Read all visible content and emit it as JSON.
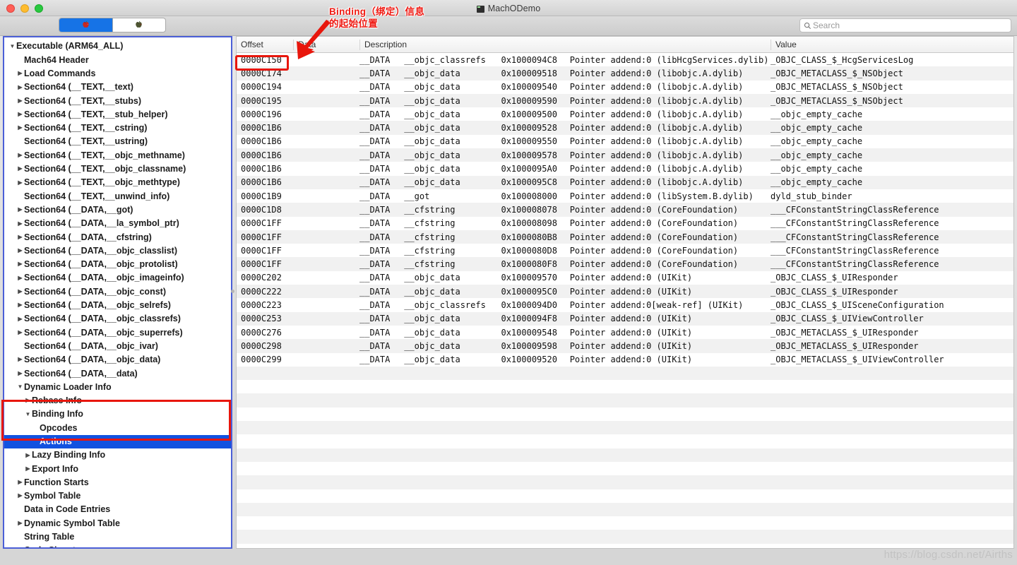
{
  "window": {
    "title": "MachODemo",
    "app_icon": "terminal-icon",
    "traffic_lights": [
      "close-button",
      "minimize-button",
      "zoom-button"
    ]
  },
  "toolbar": {
    "segmented_control": [
      {
        "icon": "red-apple-icon",
        "selected": true
      },
      {
        "icon": "dark-apple-icon",
        "selected": false
      }
    ],
    "search": {
      "icon": "search-icon",
      "placeholder": "Search",
      "value": ""
    }
  },
  "annotation": {
    "line1": "Binding（绑定）信息",
    "line2": "的起始位置",
    "color": "#ef1a13",
    "arrow": "red-arrow-icon"
  },
  "sidebar": {
    "border_color": "#4b5fd7",
    "highlight_box_color": "#e8160c",
    "selection_color": "#1252e0",
    "items": [
      {
        "label": "Executable  (ARM64_ALL)",
        "indent": 0,
        "twisty": "down",
        "selected": false
      },
      {
        "label": "Mach64 Header",
        "indent": 1,
        "twisty": "none",
        "selected": false
      },
      {
        "label": "Load Commands",
        "indent": 1,
        "twisty": "right",
        "selected": false
      },
      {
        "label": "Section64 (__TEXT,__text)",
        "indent": 1,
        "twisty": "right",
        "selected": false
      },
      {
        "label": "Section64 (__TEXT,__stubs)",
        "indent": 1,
        "twisty": "right",
        "selected": false
      },
      {
        "label": "Section64 (__TEXT,__stub_helper)",
        "indent": 1,
        "twisty": "right",
        "selected": false
      },
      {
        "label": "Section64 (__TEXT,__cstring)",
        "indent": 1,
        "twisty": "right",
        "selected": false
      },
      {
        "label": "Section64 (__TEXT,__ustring)",
        "indent": 1,
        "twisty": "none",
        "selected": false
      },
      {
        "label": "Section64 (__TEXT,__objc_methname)",
        "indent": 1,
        "twisty": "right",
        "selected": false
      },
      {
        "label": "Section64 (__TEXT,__objc_classname)",
        "indent": 1,
        "twisty": "right",
        "selected": false
      },
      {
        "label": "Section64 (__TEXT,__objc_methtype)",
        "indent": 1,
        "twisty": "right",
        "selected": false
      },
      {
        "label": "Section64 (__TEXT,__unwind_info)",
        "indent": 1,
        "twisty": "none",
        "selected": false
      },
      {
        "label": "Section64 (__DATA,__got)",
        "indent": 1,
        "twisty": "right",
        "selected": false
      },
      {
        "label": "Section64 (__DATA,__la_symbol_ptr)",
        "indent": 1,
        "twisty": "right",
        "selected": false
      },
      {
        "label": "Section64 (__DATA,__cfstring)",
        "indent": 1,
        "twisty": "right",
        "selected": false
      },
      {
        "label": "Section64 (__DATA,__objc_classlist)",
        "indent": 1,
        "twisty": "right",
        "selected": false
      },
      {
        "label": "Section64 (__DATA,__objc_protolist)",
        "indent": 1,
        "twisty": "right",
        "selected": false
      },
      {
        "label": "Section64 (__DATA,__objc_imageinfo)",
        "indent": 1,
        "twisty": "right",
        "selected": false
      },
      {
        "label": "Section64 (__DATA,__objc_const)",
        "indent": 1,
        "twisty": "right",
        "selected": false
      },
      {
        "label": "Section64 (__DATA,__objc_selrefs)",
        "indent": 1,
        "twisty": "right",
        "selected": false
      },
      {
        "label": "Section64 (__DATA,__objc_classrefs)",
        "indent": 1,
        "twisty": "right",
        "selected": false
      },
      {
        "label": "Section64 (__DATA,__objc_superrefs)",
        "indent": 1,
        "twisty": "right",
        "selected": false
      },
      {
        "label": "Section64 (__DATA,__objc_ivar)",
        "indent": 1,
        "twisty": "none",
        "selected": false
      },
      {
        "label": "Section64 (__DATA,__objc_data)",
        "indent": 1,
        "twisty": "right",
        "selected": false
      },
      {
        "label": "Section64 (__DATA,__data)",
        "indent": 1,
        "twisty": "right",
        "selected": false
      },
      {
        "label": "Dynamic Loader Info",
        "indent": 1,
        "twisty": "down",
        "selected": false
      },
      {
        "label": "Rebase Info",
        "indent": 2,
        "twisty": "right",
        "selected": false
      },
      {
        "label": "Binding Info",
        "indent": 2,
        "twisty": "down",
        "selected": false
      },
      {
        "label": "Opcodes",
        "indent": 3,
        "twisty": "none",
        "selected": false
      },
      {
        "label": "Actions",
        "indent": 3,
        "twisty": "none",
        "selected": true
      },
      {
        "label": "Lazy Binding Info",
        "indent": 2,
        "twisty": "right",
        "selected": false
      },
      {
        "label": "Export Info",
        "indent": 2,
        "twisty": "right",
        "selected": false
      },
      {
        "label": "Function Starts",
        "indent": 1,
        "twisty": "right",
        "selected": false
      },
      {
        "label": "Symbol Table",
        "indent": 1,
        "twisty": "right",
        "selected": false
      },
      {
        "label": "Data in Code Entries",
        "indent": 1,
        "twisty": "none",
        "selected": false
      },
      {
        "label": "Dynamic Symbol Table",
        "indent": 1,
        "twisty": "right",
        "selected": false
      },
      {
        "label": "String Table",
        "indent": 1,
        "twisty": "none",
        "selected": false
      },
      {
        "label": "Code Signature",
        "indent": 1,
        "twisty": "none",
        "selected": false
      }
    ]
  },
  "table": {
    "columns": [
      "Offset",
      "Data",
      "Description",
      "Value"
    ],
    "rows": [
      {
        "offset": "0000C150",
        "data": "",
        "seg": "__DATA",
        "sect": "__objc_classrefs",
        "addr": "0x1000094C8",
        "kind": "Pointer addend:0",
        "lib": "(libHcgServices.dylib)",
        "value": "_OBJC_CLASS_$_HcgServicesLog"
      },
      {
        "offset": "0000C174",
        "data": "",
        "seg": "__DATA",
        "sect": "__objc_data",
        "addr": "0x100009518",
        "kind": "Pointer addend:0",
        "lib": "(libobjc.A.dylib)",
        "value": "_OBJC_METACLASS_$_NSObject"
      },
      {
        "offset": "0000C194",
        "data": "",
        "seg": "__DATA",
        "sect": "__objc_data",
        "addr": "0x100009540",
        "kind": "Pointer addend:0",
        "lib": "(libobjc.A.dylib)",
        "value": "_OBJC_METACLASS_$_NSObject"
      },
      {
        "offset": "0000C195",
        "data": "",
        "seg": "__DATA",
        "sect": "__objc_data",
        "addr": "0x100009590",
        "kind": "Pointer addend:0",
        "lib": "(libobjc.A.dylib)",
        "value": "_OBJC_METACLASS_$_NSObject"
      },
      {
        "offset": "0000C196",
        "data": "",
        "seg": "__DATA",
        "sect": "__objc_data",
        "addr": "0x100009500",
        "kind": "Pointer addend:0",
        "lib": "(libobjc.A.dylib)",
        "value": "__objc_empty_cache"
      },
      {
        "offset": "0000C1B6",
        "data": "",
        "seg": "__DATA",
        "sect": "__objc_data",
        "addr": "0x100009528",
        "kind": "Pointer addend:0",
        "lib": "(libobjc.A.dylib)",
        "value": "__objc_empty_cache"
      },
      {
        "offset": "0000C1B6",
        "data": "",
        "seg": "__DATA",
        "sect": "__objc_data",
        "addr": "0x100009550",
        "kind": "Pointer addend:0",
        "lib": "(libobjc.A.dylib)",
        "value": "__objc_empty_cache"
      },
      {
        "offset": "0000C1B6",
        "data": "",
        "seg": "__DATA",
        "sect": "__objc_data",
        "addr": "0x100009578",
        "kind": "Pointer addend:0",
        "lib": "(libobjc.A.dylib)",
        "value": "__objc_empty_cache"
      },
      {
        "offset": "0000C1B6",
        "data": "",
        "seg": "__DATA",
        "sect": "__objc_data",
        "addr": "0x1000095A0",
        "kind": "Pointer addend:0",
        "lib": "(libobjc.A.dylib)",
        "value": "__objc_empty_cache"
      },
      {
        "offset": "0000C1B6",
        "data": "",
        "seg": "__DATA",
        "sect": "__objc_data",
        "addr": "0x1000095C8",
        "kind": "Pointer addend:0",
        "lib": "(libobjc.A.dylib)",
        "value": "__objc_empty_cache"
      },
      {
        "offset": "0000C1B9",
        "data": "",
        "seg": "__DATA",
        "sect": "__got",
        "addr": "0x100008000",
        "kind": "Pointer addend:0",
        "lib": "(libSystem.B.dylib)",
        "value": "dyld_stub_binder"
      },
      {
        "offset": "0000C1D8",
        "data": "",
        "seg": "__DATA",
        "sect": "__cfstring",
        "addr": "0x100008078",
        "kind": "Pointer addend:0",
        "lib": "(CoreFoundation)",
        "value": "___CFConstantStringClassReference"
      },
      {
        "offset": "0000C1FF",
        "data": "",
        "seg": "__DATA",
        "sect": "__cfstring",
        "addr": "0x100008098",
        "kind": "Pointer addend:0",
        "lib": "(CoreFoundation)",
        "value": "___CFConstantStringClassReference"
      },
      {
        "offset": "0000C1FF",
        "data": "",
        "seg": "__DATA",
        "sect": "__cfstring",
        "addr": "0x1000080B8",
        "kind": "Pointer addend:0",
        "lib": "(CoreFoundation)",
        "value": "___CFConstantStringClassReference"
      },
      {
        "offset": "0000C1FF",
        "data": "",
        "seg": "__DATA",
        "sect": "__cfstring",
        "addr": "0x1000080D8",
        "kind": "Pointer addend:0",
        "lib": "(CoreFoundation)",
        "value": "___CFConstantStringClassReference"
      },
      {
        "offset": "0000C1FF",
        "data": "",
        "seg": "__DATA",
        "sect": "__cfstring",
        "addr": "0x1000080F8",
        "kind": "Pointer addend:0",
        "lib": "(CoreFoundation)",
        "value": "___CFConstantStringClassReference"
      },
      {
        "offset": "0000C202",
        "data": "",
        "seg": "__DATA",
        "sect": "__objc_data",
        "addr": "0x100009570",
        "kind": "Pointer addend:0",
        "lib": "(UIKit)",
        "value": "_OBJC_CLASS_$_UIResponder"
      },
      {
        "offset": "0000C222",
        "data": "",
        "seg": "__DATA",
        "sect": "__objc_data",
        "addr": "0x1000095C0",
        "kind": "Pointer addend:0",
        "lib": "(UIKit)",
        "value": "_OBJC_CLASS_$_UIResponder"
      },
      {
        "offset": "0000C223",
        "data": "",
        "seg": "__DATA",
        "sect": "__objc_classrefs",
        "addr": "0x1000094D0",
        "kind": "Pointer addend:0[weak-ref]",
        "lib": "(UIKit)",
        "value": "_OBJC_CLASS_$_UISceneConfiguration"
      },
      {
        "offset": "0000C253",
        "data": "",
        "seg": "__DATA",
        "sect": "__objc_data",
        "addr": "0x1000094F8",
        "kind": "Pointer addend:0",
        "lib": "(UIKit)",
        "value": "_OBJC_CLASS_$_UIViewController"
      },
      {
        "offset": "0000C276",
        "data": "",
        "seg": "__DATA",
        "sect": "__objc_data",
        "addr": "0x100009548",
        "kind": "Pointer addend:0",
        "lib": "(UIKit)",
        "value": "_OBJC_METACLASS_$_UIResponder"
      },
      {
        "offset": "0000C298",
        "data": "",
        "seg": "__DATA",
        "sect": "__objc_data",
        "addr": "0x100009598",
        "kind": "Pointer addend:0",
        "lib": "(UIKit)",
        "value": "_OBJC_METACLASS_$_UIResponder"
      },
      {
        "offset": "0000C299",
        "data": "",
        "seg": "__DATA",
        "sect": "__objc_data",
        "addr": "0x100009520",
        "kind": "Pointer addend:0",
        "lib": "(UIKit)",
        "value": "_OBJC_METACLASS_$_UIViewController"
      }
    ]
  },
  "watermark": "https://blog.csdn.net/Airths"
}
